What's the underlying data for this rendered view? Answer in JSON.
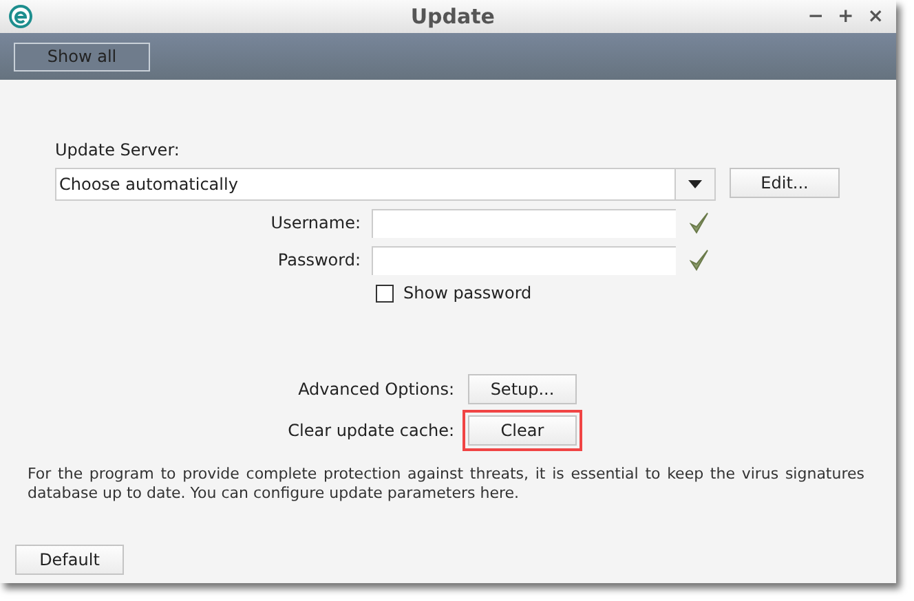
{
  "window": {
    "title": "Update",
    "controls": [
      "−",
      "+",
      "×"
    ]
  },
  "toolbar": {
    "show_all": "Show all"
  },
  "server": {
    "label": "Update Server:",
    "value": "Choose automatically",
    "edit": "Edit..."
  },
  "credentials": [
    {
      "label": "Username:"
    },
    {
      "label": "Password:"
    }
  ],
  "show_password": {
    "label": "Show password",
    "checked": false
  },
  "actions": [
    {
      "label": "Advanced Options:",
      "button": "Setup...",
      "highlighted": false
    },
    {
      "label": "Clear update cache:",
      "button": "Clear",
      "highlighted": true
    }
  ],
  "description": "For the program to provide complete protection against threats, it is essential to keep the virus signatures database up to date. You can configure update parameters here.",
  "default_button": "Default"
}
